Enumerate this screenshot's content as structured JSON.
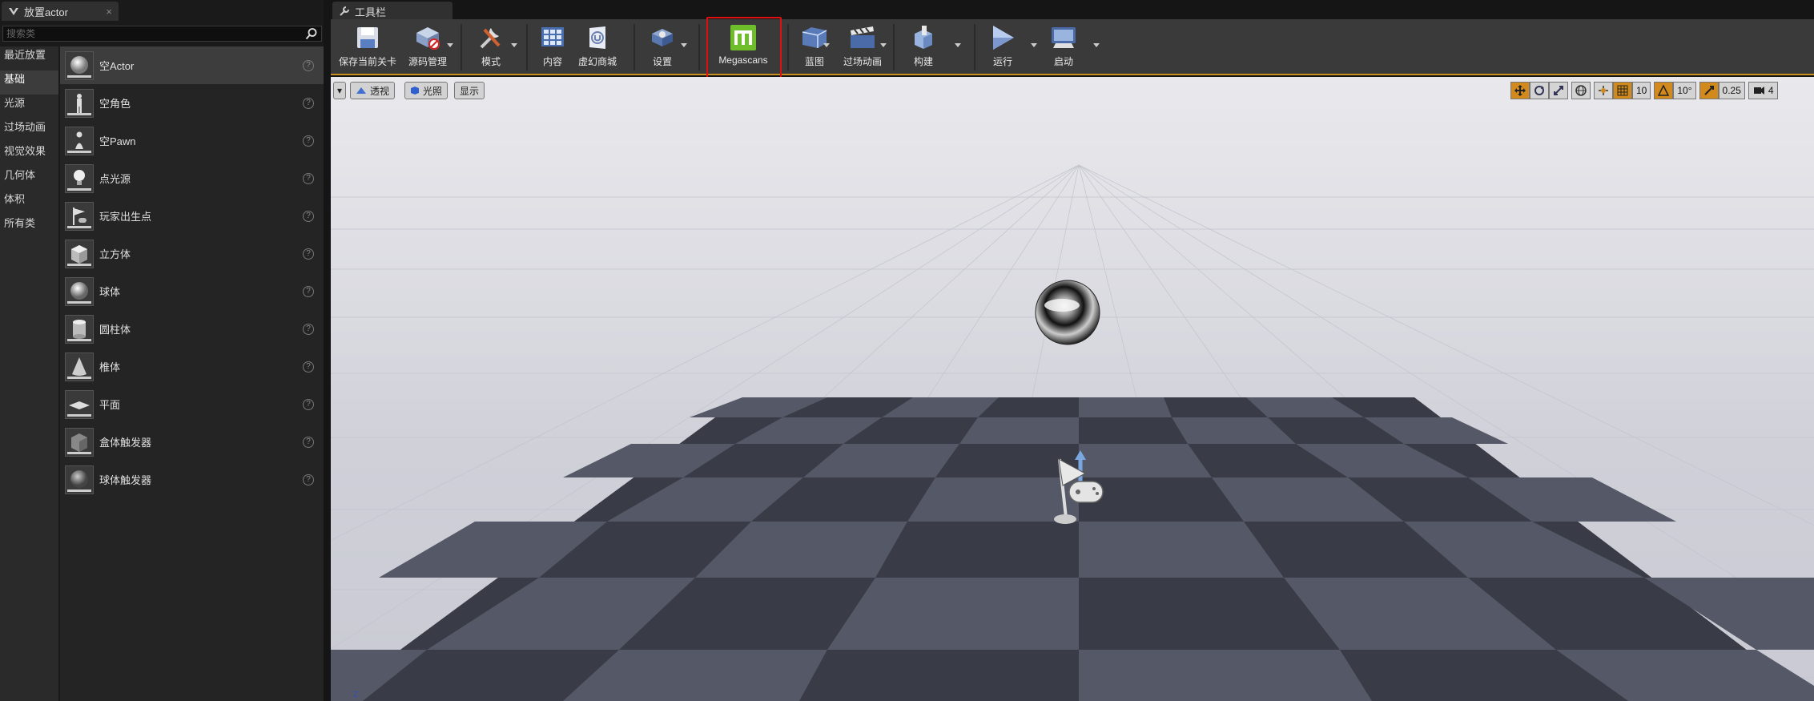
{
  "left_panel": {
    "tab_title": "放置actor",
    "close": "×",
    "search_placeholder": "搜索类",
    "categories": [
      "最近放置",
      "基础",
      "光源",
      "过场动画",
      "视觉效果",
      "几何体",
      "体积",
      "所有类"
    ],
    "active_category": "基础",
    "assets": [
      {
        "label": "空Actor",
        "icon": "empty-actor-icon"
      },
      {
        "label": "空角色",
        "icon": "character-icon"
      },
      {
        "label": "空Pawn",
        "icon": "pawn-icon"
      },
      {
        "label": "点光源",
        "icon": "point-light-icon"
      },
      {
        "label": "玩家出生点",
        "icon": "player-start-icon"
      },
      {
        "label": "立方体",
        "icon": "cube-icon"
      },
      {
        "label": "球体",
        "icon": "sphere-icon"
      },
      {
        "label": "圆柱体",
        "icon": "cylinder-icon"
      },
      {
        "label": "椎体",
        "icon": "cone-icon"
      },
      {
        "label": "平面",
        "icon": "plane-icon"
      },
      {
        "label": "盒体触发器",
        "icon": "box-trigger-icon"
      },
      {
        "label": "球体触发器",
        "icon": "sphere-trigger-icon"
      }
    ],
    "help_glyph": "?"
  },
  "toolbar": {
    "tab_title": "工具栏",
    "buttons": [
      {
        "label": "保存当前关卡",
        "icon": "save-icon"
      },
      {
        "label": "源码管理",
        "icon": "source-control-icon"
      },
      {
        "label": "模式",
        "icon": "modes-icon"
      },
      {
        "label": "内容",
        "icon": "content-icon"
      },
      {
        "label": "虚幻商城",
        "icon": "marketplace-icon"
      },
      {
        "label": "设置",
        "icon": "settings-icon"
      },
      {
        "label": "Megascans",
        "icon": "megascans-icon"
      },
      {
        "label": "蓝图",
        "icon": "blueprint-icon"
      },
      {
        "label": "过场动画",
        "icon": "cinematics-icon"
      },
      {
        "label": "构建",
        "icon": "build-icon"
      },
      {
        "label": "运行",
        "icon": "play-icon"
      },
      {
        "label": "启动",
        "icon": "launch-icon"
      }
    ],
    "accent_color": "#c68f1e",
    "highlight_color": "#e01010"
  },
  "viewport": {
    "menu_arrow": "▾",
    "perspective": "透视",
    "lit": "光照",
    "show": "显示",
    "grid_snap": "10",
    "rotation_snap": "10°",
    "scale_snap": "0.25",
    "camera_speed": "4",
    "axis": "Z"
  }
}
